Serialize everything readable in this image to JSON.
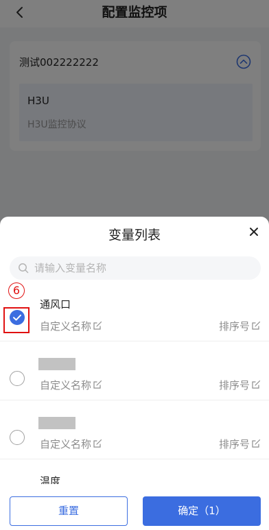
{
  "header": {
    "title": "配置监控项"
  },
  "card": {
    "device_name": "测试002222222",
    "protocol_name": "H3U",
    "protocol_desc": "H3U监控协议"
  },
  "sheet": {
    "title": "变量列表",
    "search_placeholder": "请输入变量名称",
    "items": [
      {
        "name": "通风口",
        "checked": true,
        "custom_name_label": "自定义名称",
        "sort_label": "排序号"
      },
      {
        "name": "",
        "checked": false,
        "custom_name_label": "自定义名称",
        "sort_label": "排序号"
      },
      {
        "name": "",
        "checked": false,
        "custom_name_label": "自定义名称",
        "sort_label": "排序号"
      },
      {
        "name": "温度",
        "checked": false
      }
    ]
  },
  "annotation": {
    "number": "6"
  },
  "footer": {
    "reset_label": "重置",
    "confirm_label": "确定（1）"
  },
  "colors": {
    "accent": "#3b6de0",
    "annotation": "#e01010"
  }
}
